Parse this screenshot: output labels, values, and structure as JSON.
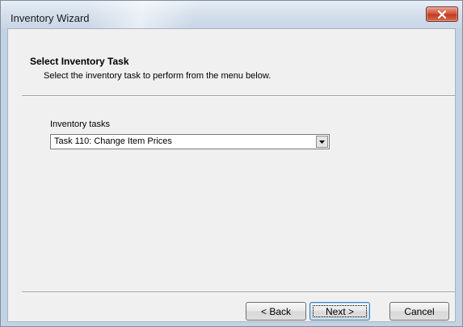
{
  "window": {
    "title": "Inventory Wizard"
  },
  "header": {
    "title": "Select Inventory Task",
    "subtitle": "Select the inventory task to perform from the menu below."
  },
  "form": {
    "tasks_label": "Inventory tasks",
    "tasks_selected": "Task 110: Change Item Prices"
  },
  "buttons": {
    "back_label": "< Back",
    "next_label": "Next >",
    "cancel_label": "Cancel"
  },
  "icons": {
    "close": "close-icon",
    "dropdown": "chevron-down-icon"
  },
  "colors": {
    "close_button": "#c03d20",
    "default_button_border": "#3c7fb1"
  }
}
